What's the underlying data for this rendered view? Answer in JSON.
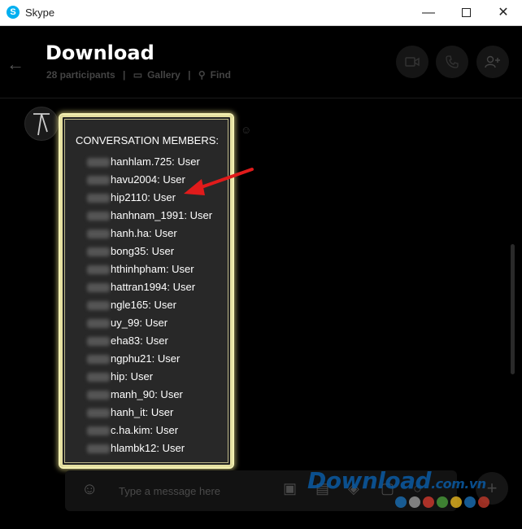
{
  "window": {
    "app_name": "Skype",
    "minimize": "—",
    "close": "✕"
  },
  "header": {
    "title": "Download",
    "participants": "28 participants",
    "gallery": "Gallery",
    "find": "Find"
  },
  "members": {
    "title": "CONVERSATION MEMBERS:",
    "items": [
      "hanhlam.725: User",
      "havu2004: User",
      "hip2110: User",
      "hanhnam_1991: User",
      "hanh.ha: User",
      "bong35: User",
      "hthinhpham: User",
      "hattran1994: User",
      "ngle165: User",
      "uy_99: User",
      "eha83: User",
      "ngphu21: User",
      "hip: User",
      "manh_90: User",
      "hanh_it: User",
      "c.ha.kim: User",
      "hlambk12: User"
    ]
  },
  "composer": {
    "placeholder": "Type a message here"
  },
  "watermark": {
    "brand": "Download",
    "tld": ".com.vn",
    "dot_colors": [
      "#1a6fb5",
      "#9b9b9b",
      "#d23a2e",
      "#4a9c3b",
      "#e8b820",
      "#1a6fb5",
      "#c0392b"
    ]
  },
  "colors": {
    "highlight_border": "#f3f0b2",
    "arrow": "#e01b1b",
    "skype_blue": "#00aff0"
  }
}
